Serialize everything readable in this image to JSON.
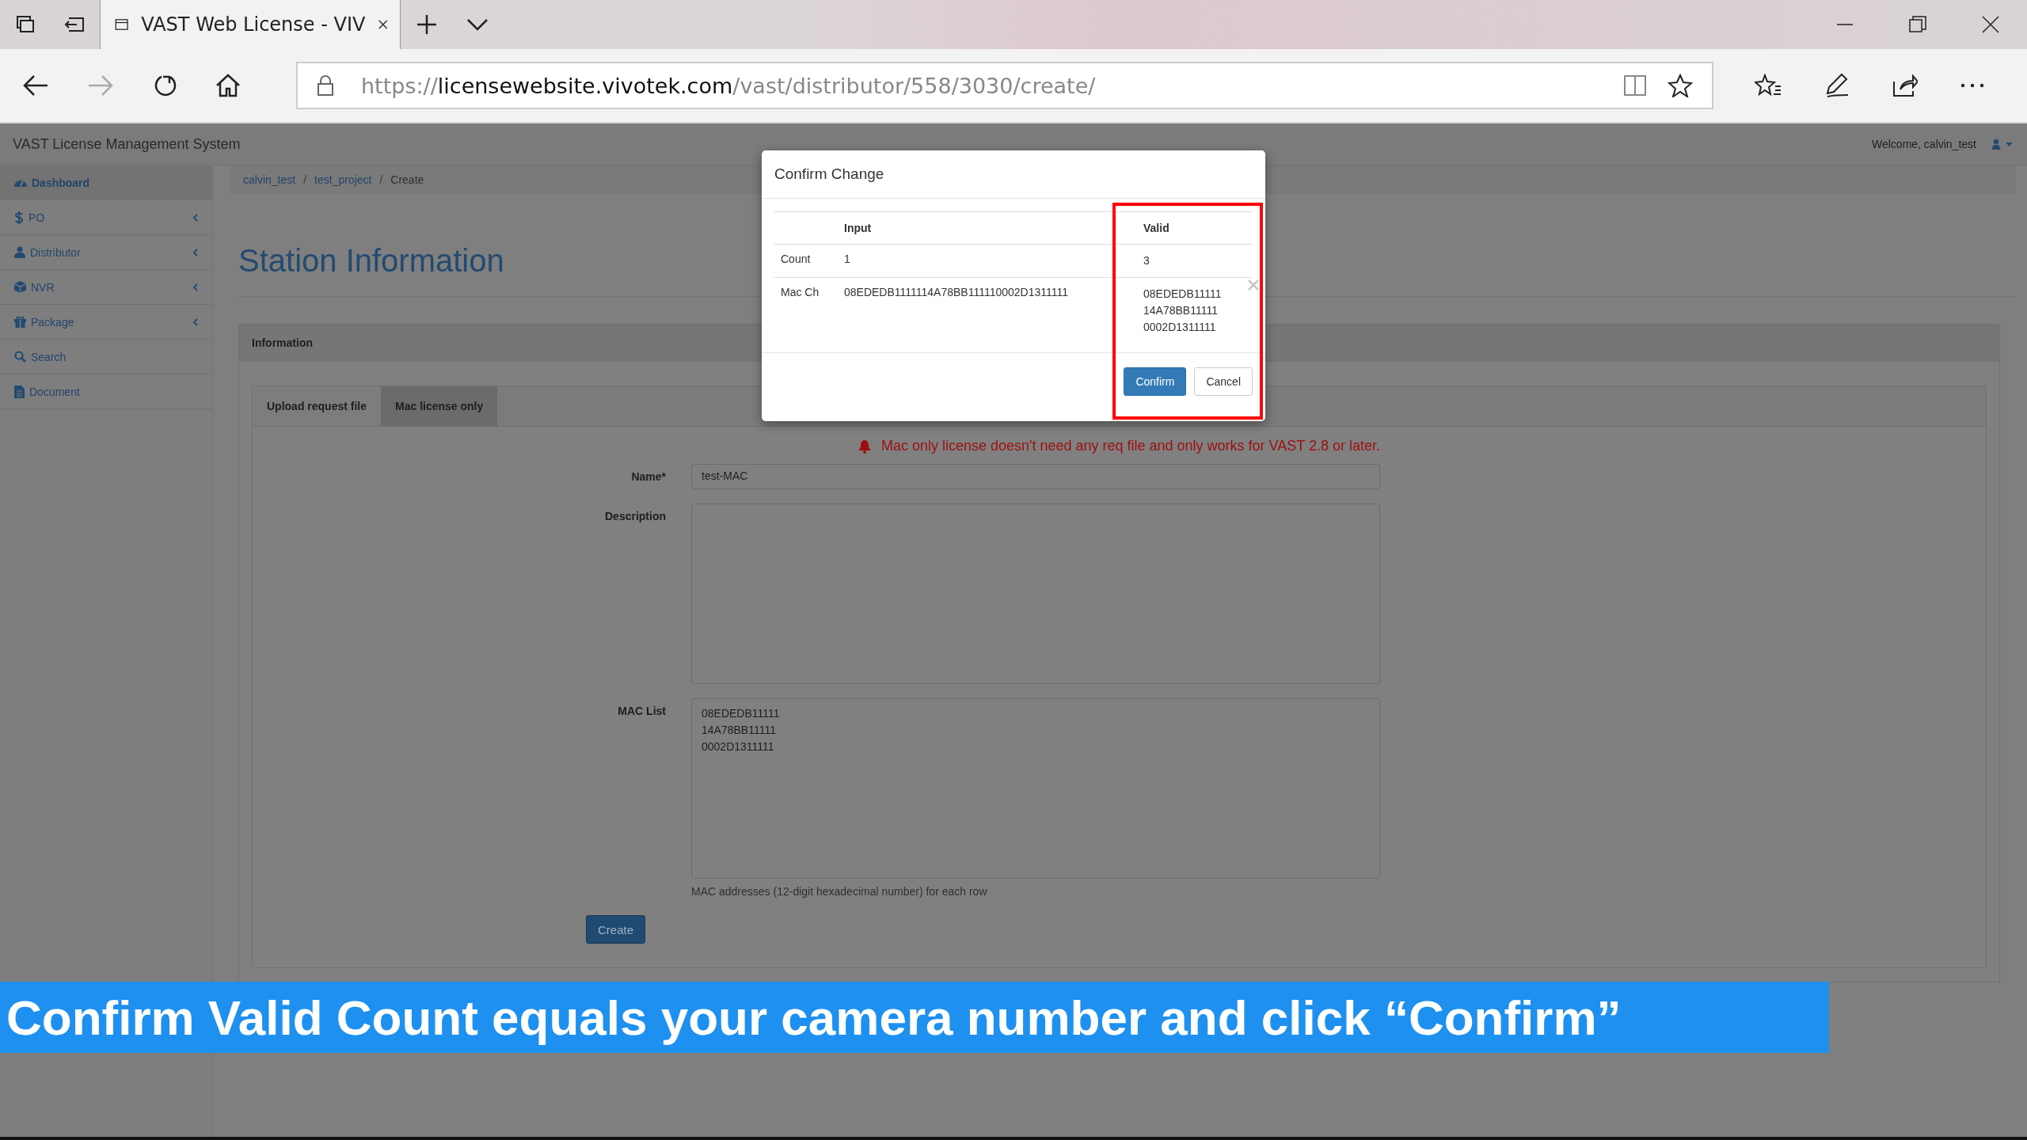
{
  "browser": {
    "tabs": [
      {
        "title": "VAST Web License - VIV",
        "selected": true
      }
    ],
    "url": {
      "scheme": "https://",
      "domain": "licensewebsite.vivotek.com",
      "path": "/vast/distributor/558/3030/create/"
    }
  },
  "app": {
    "title": "VAST License Management System",
    "welcome": "Welcome, calvin_test"
  },
  "sidebar": {
    "items": [
      {
        "label": "Dashboard",
        "selected": true,
        "submenu": false
      },
      {
        "label": "PO",
        "selected": false,
        "submenu": true
      },
      {
        "label": "Distributor",
        "selected": false,
        "submenu": true
      },
      {
        "label": "NVR",
        "selected": false,
        "submenu": true
      },
      {
        "label": "Package",
        "selected": false,
        "submenu": true
      },
      {
        "label": "Search",
        "selected": false,
        "submenu": false
      },
      {
        "label": "Document",
        "selected": false,
        "submenu": false
      }
    ]
  },
  "breadcrumb": [
    "calvin_test",
    "test_project",
    "Create"
  ],
  "breadcrumb_separator": "/",
  "page_title": "Station Information",
  "panel": {
    "title": "Information",
    "tabs": [
      {
        "label": "Upload request file",
        "selected": false
      },
      {
        "label": "Mac license only",
        "selected": true
      }
    ],
    "notice": "Mac only license doesn't need any req file and only works for VAST 2.8 or later.",
    "fields": [
      {
        "kind": "input",
        "label": "Name*",
        "value": "test-MAC"
      },
      {
        "kind": "textarea",
        "label": "Description"
      },
      {
        "kind": "textarea",
        "label": "MAC List",
        "lines": [
          "08EDEDB11111",
          "14A78BB11111",
          "0002D1311111"
        ],
        "help": "MAC addresses (12-digit hexadecimal number) for each row"
      }
    ],
    "button": "Create"
  },
  "modal": {
    "title": "Confirm Change",
    "columns": [
      "Input",
      "Valid"
    ],
    "rows": [
      {
        "label": "Count",
        "input": "1",
        "valid": [
          "3"
        ]
      },
      {
        "label": "Mac Ch",
        "input": "08EDEDB1111114A78BB111110002D1311111",
        "valid": [
          "08EDEDB11111",
          "14A78BB11111",
          "0002D1311111"
        ]
      }
    ],
    "buttons": [
      {
        "label": "Confirm",
        "kind": "primary"
      },
      {
        "label": "Cancel",
        "kind": "default"
      }
    ],
    "highlight": true
  },
  "caption": "Confirm Valid Count equals your camera number and click “Confirm”"
}
